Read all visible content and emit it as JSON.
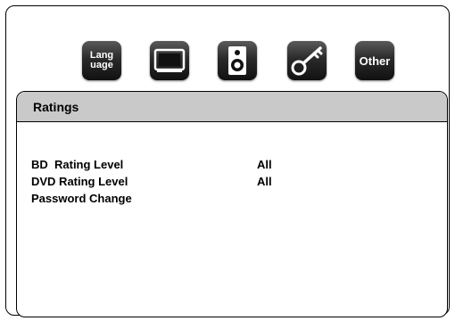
{
  "icons": [
    {
      "name": "language-icon",
      "label": "Lang\nuage"
    },
    {
      "name": "display-icon"
    },
    {
      "name": "audio-speaker-icon"
    },
    {
      "name": "key-icon"
    },
    {
      "name": "other-icon",
      "label": "Other"
    }
  ],
  "panel": {
    "title": "Ratings",
    "rows": [
      {
        "label": "BD  Rating Level",
        "value": "All"
      },
      {
        "label": "DVD Rating Level",
        "value": "All"
      },
      {
        "label": "Password Change",
        "value": ""
      }
    ]
  },
  "colors": {
    "header_bg": "#c9c9c9",
    "icon_bg": "#222222",
    "text": "#000000"
  }
}
